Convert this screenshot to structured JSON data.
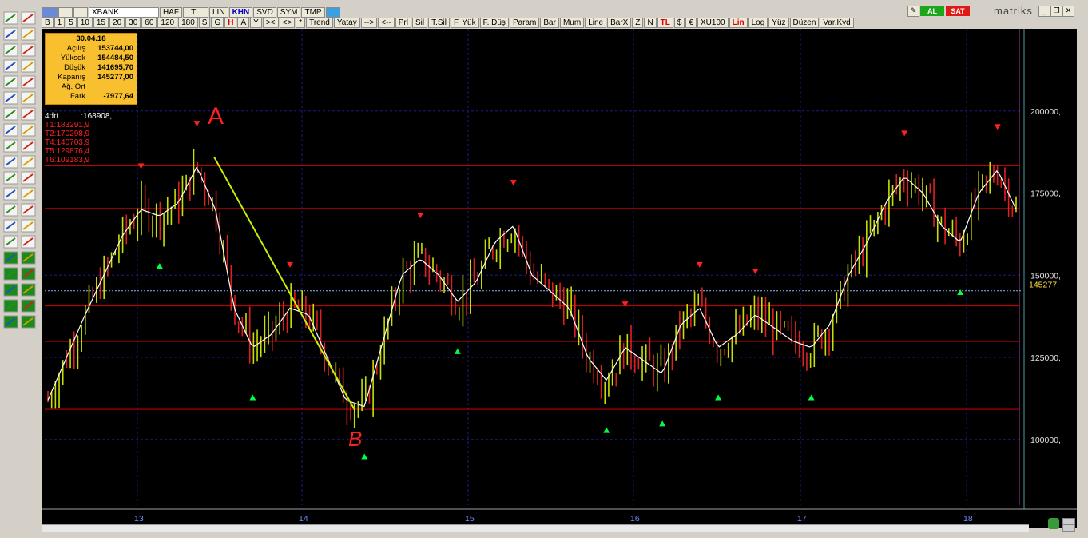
{
  "window": {
    "minimize_glyph": "_",
    "restore_glyph": "❐",
    "close_glyph": "✕"
  },
  "toolbar1": {
    "symbol": "XBANK",
    "buttons": [
      "HAF",
      "TL",
      "LIN",
      "KHN",
      "SVD",
      "SYM",
      "TMP"
    ],
    "al": "AL",
    "sat": "SAT",
    "brand": "matriks"
  },
  "toolbar2": {
    "buttons": [
      "B",
      "1",
      "5",
      "10",
      "15",
      "20",
      "30",
      "60",
      "120",
      "180",
      "S",
      "G",
      "H",
      "A",
      "Y",
      "><",
      "<>",
      "*",
      "Trend",
      "Yatay",
      "-->",
      "<--",
      "Prl",
      "Sil",
      "T.Sil",
      "F. Yük",
      "F. Düş",
      "Param",
      "Bar",
      "Mum",
      "Line",
      "BarX",
      "Z",
      "N",
      "TL",
      "$",
      "€",
      "XU100",
      "Lin",
      "Log",
      "Yüz",
      "Düzen",
      "Var.Kyd"
    ]
  },
  "price_box": {
    "date": "30.04.18",
    "rows": [
      {
        "label": "Açılış",
        "value": "153744,00"
      },
      {
        "label": "Yüksek",
        "value": "154484,50"
      },
      {
        "label": "Düşük",
        "value": "141695,70"
      },
      {
        "label": "Kapanış",
        "value": "145277,00"
      },
      {
        "label": "Ağ. Ort",
        "value": ""
      },
      {
        "label": "Fark",
        "value": "-7977,64"
      }
    ]
  },
  "indicator": {
    "name": "4drt",
    "value": ":168908,",
    "targets": [
      "T1:183291,9",
      "T2:170298,9",
      "T4:140703,9",
      "T5:129876,4",
      "T6:109183,9"
    ]
  },
  "chart_data": {
    "type": "bar",
    "symbol": "XBANK",
    "y_ticks": [
      100000,
      125000,
      150000,
      175000,
      200000
    ],
    "y_tick_labels": [
      "100000,",
      "125000,",
      "150000,",
      "175000,",
      "200000,"
    ],
    "ylim": [
      80000,
      225000
    ],
    "x_ticks": [
      "13",
      "14",
      "15",
      "16",
      "17",
      "18"
    ],
    "last_price": 145277,
    "last_price_label": "145277,",
    "horizontal_levels": [
      183291.9,
      170298.9,
      140703.9,
      129876.4,
      109183.9
    ],
    "annotations": [
      "A",
      "B"
    ],
    "trendline": {
      "from": {
        "x": "13 (late)",
        "y": 186000
      },
      "to": {
        "x": "14 (late)",
        "y": 109000
      }
    },
    "series": [
      {
        "name": "4drt",
        "values": [
          112000,
          125000,
          138000,
          150000,
          162000,
          170000,
          168000,
          172000,
          183000,
          170000,
          140000,
          128000,
          132000,
          140000,
          138000,
          125000,
          112000,
          110000,
          130000,
          150000,
          155000,
          150000,
          142000,
          148000,
          160000,
          165000,
          150000,
          145000,
          140000,
          125000,
          118000,
          128000,
          124000,
          120000,
          135000,
          140000,
          128000,
          132000,
          138000,
          134000,
          130000,
          128000,
          135000,
          150000,
          160000,
          172000,
          180000,
          175000,
          165000,
          160000,
          175000,
          182000,
          170000
        ]
      }
    ],
    "colors": {
      "up": "#c8e000",
      "down": "#e02020",
      "smooth": "#ffffff",
      "level": "#c00000",
      "trend": "#c8f000",
      "buy_signal": "#00ff44",
      "sell_signal": "#ff2020",
      "grid": "#1c1c8c"
    }
  }
}
